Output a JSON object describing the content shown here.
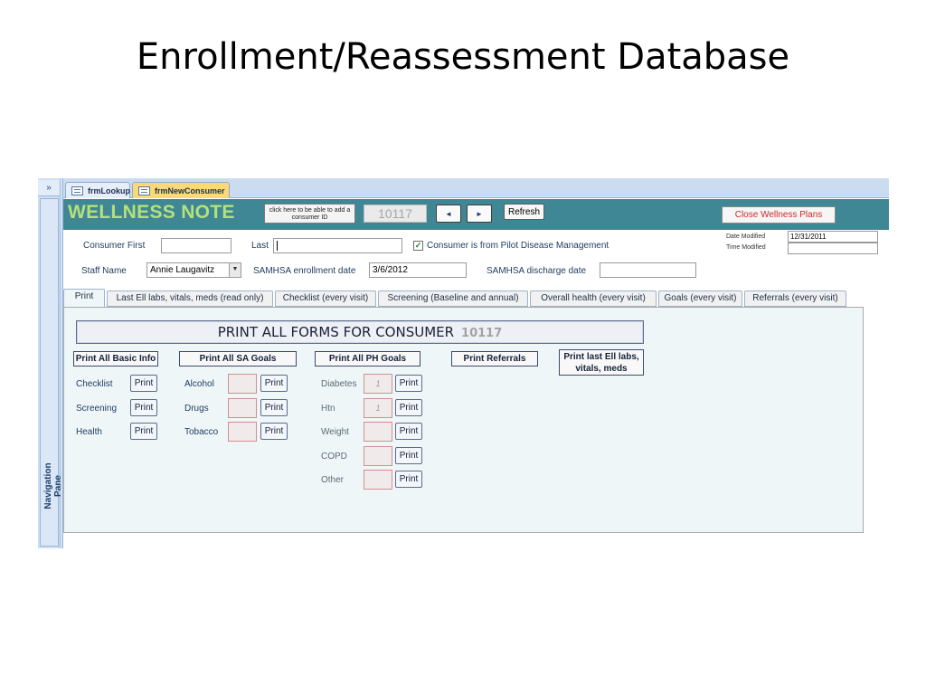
{
  "slide": {
    "title": "Enrollment/Reassessment Database"
  },
  "nav_pane": {
    "toggle": "»",
    "label": "Navigation Pane"
  },
  "doc_tabs": [
    {
      "label": "frmLookup"
    },
    {
      "label": "frmNewConsumer"
    }
  ],
  "header": {
    "title": "WELLNESS NOTE",
    "add_id_button": "click here to be able to add a consumer ID",
    "consumer_id": "10117",
    "prev_glyph": "◄",
    "next_glyph": "►",
    "refresh": "Refresh",
    "close": "Close Wellness Plans"
  },
  "consumer": {
    "first_label": "Consumer First",
    "first_value": "",
    "last_label": "Last",
    "last_value": "",
    "pilot_checkbox_label": "Consumer is from Pilot Disease Management",
    "pilot_checked": "✓",
    "staff_label": "Staff Name",
    "staff_value": "Annie Laugavitz",
    "dropdown_glyph": "▼",
    "samhsa_enroll_label": "SAMHSA enrollment date",
    "samhsa_enroll_value": "3/6/2012",
    "samhsa_discharge_label": "SAMHSA discharge date",
    "samhsa_discharge_value": "",
    "date_modified_label": "Date Modified",
    "date_modified_value": "12/31/2011",
    "time_modified_label": "Time Modified",
    "time_modified_value": ""
  },
  "form_tabs": [
    "Print",
    "Last Ell labs, vitals, meds (read only)",
    "Checklist (every visit)",
    "Screening (Baseline and annual)",
    "Overall health (every visit)",
    "Goals (every visit)",
    "Referrals (every visit)"
  ],
  "print_tab": {
    "print_all_label": "PRINT ALL FORMS FOR CONSUMER",
    "consumer_id": "10117",
    "print_label": "Print",
    "basic": {
      "button": "Print All Basic Info",
      "rows": [
        "Checklist",
        "Screening",
        "Health"
      ]
    },
    "sa": {
      "button": "Print All SA Goals",
      "rows": [
        "Alcohol",
        "Drugs",
        "Tobacco"
      ]
    },
    "ph": {
      "button": "Print All PH Goals",
      "rows": [
        {
          "label": "Diabetes",
          "value": "1"
        },
        {
          "label": "Htn",
          "value": "1"
        },
        {
          "label": "Weight",
          "value": ""
        },
        {
          "label": "COPD",
          "value": ""
        },
        {
          "label": "Other",
          "value": ""
        }
      ]
    },
    "referrals_button": "Print Referrals",
    "labs_button_line1": "Print last Ell labs,",
    "labs_button_line2": "vitals, meds"
  }
}
